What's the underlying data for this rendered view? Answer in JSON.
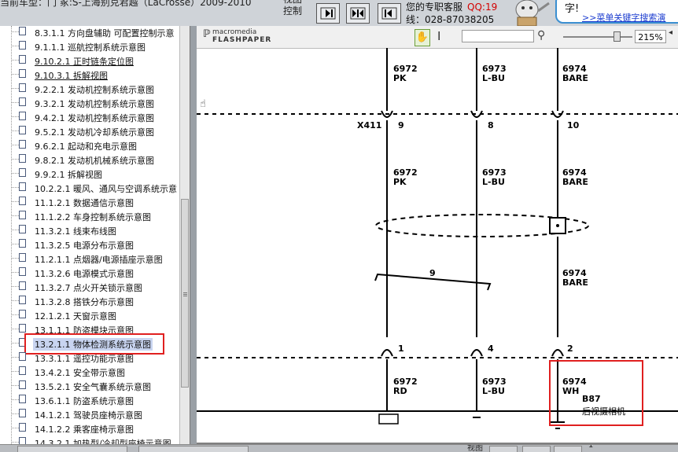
{
  "header": {
    "vehicle_text": "当前车型：门 冢:S-上海别克君越（LaCrosse）2009-2010",
    "view_control_label": "视图控制",
    "service_label": "您的专职客服",
    "qq_label": "QQ:19",
    "phone_label": "线：028-87038205",
    "bubble_title": "字!",
    "bubble_link": ">>菜单关键字搜索演"
  },
  "sidebar": {
    "items": [
      {
        "label": "8.3.1.1 方向盘辅助 可配置控制示意"
      },
      {
        "label": "9.1.1.1 巡航控制系统示意图"
      },
      {
        "label": "9.10.2.1 正时链条定位图"
      },
      {
        "label": "9.10.3.1 拆解视图"
      },
      {
        "label": "9.2.2.1 发动机控制系统示意图"
      },
      {
        "label": "9.3.2.1 发动机控制系统示意图"
      },
      {
        "label": "9.4.2.1 发动机控制系统示意图"
      },
      {
        "label": "9.5.2.1 发动机冷却系统示意图"
      },
      {
        "label": "9.6.2.1 起动和充电示意图"
      },
      {
        "label": "9.8.2.1 发动机机械系统示意图"
      },
      {
        "label": "9.9.2.1 拆解视图"
      },
      {
        "label": "10.2.2.1 暖风、通风与空调系统示意"
      },
      {
        "label": "11.1.2.1 数据通信示意图"
      },
      {
        "label": "11.1.2.2 车身控制系统示意图"
      },
      {
        "label": "11.3.2.1 线束布线图"
      },
      {
        "label": "11.3.2.5 电源分布示意图"
      },
      {
        "label": "11.2.1.1 点烟器/电源插座示意图"
      },
      {
        "label": "11.3.2.6 电源模式示意图"
      },
      {
        "label": "11.3.2.7 点火开关锁示意图"
      },
      {
        "label": "11.3.2.8 搭铁分布示意图"
      },
      {
        "label": "12.1.2.1 天窗示意图"
      },
      {
        "label": "13.1.1.1 防盗模块示意图"
      },
      {
        "label": "13.2.1.1 物体检测系统示意图"
      },
      {
        "label": "13.3.1.1 遥控功能示意图"
      },
      {
        "label": "13.4.2.1 安全带示意图"
      },
      {
        "label": "13.5.2.1 安全气囊系统示意图"
      },
      {
        "label": "13.6.1.1 防盗系统示意图"
      },
      {
        "label": "14.1.2.1 驾驶员座椅示意图"
      },
      {
        "label": "14.1.2.2 乘客座椅示意图"
      },
      {
        "label": "14.3.2.1 加热型/冷却型座椅示意图"
      }
    ],
    "selected_label": "13.2.1.1 物体检测系统示意图"
  },
  "viewer": {
    "brand_top": "macromedia",
    "brand_bottom": "FLASHPAPER",
    "search_value": "",
    "zoom": "215%"
  },
  "diagram": {
    "top_wires": [
      {
        "circuit": "6972",
        "color": "PK"
      },
      {
        "circuit": "6973",
        "color": "L-BU"
      },
      {
        "circuit": "6974",
        "color": "BARE"
      }
    ],
    "connector_x411": {
      "name": "X411",
      "pins": [
        "9",
        "8",
        "10"
      ]
    },
    "mid_wires": [
      {
        "circuit": "6972",
        "color": "PK"
      },
      {
        "circuit": "6973",
        "color": "L-BU"
      },
      {
        "circuit": "6974",
        "color": "BARE"
      }
    ],
    "twist_label": "9",
    "drain_wire": {
      "circuit": "6974",
      "color": "BARE"
    },
    "lower_pins": [
      "1",
      "4",
      "2"
    ],
    "bottom_wires": [
      {
        "circuit": "6972",
        "color": "RD"
      },
      {
        "circuit": "6973",
        "color": "L-BU"
      },
      {
        "circuit": "6974",
        "color": "WH"
      }
    ],
    "component": {
      "id": "B87",
      "name": "后视摄相机"
    }
  },
  "footer": {
    "view_label": "视图",
    "page_label": "1"
  },
  "colors": {
    "highlight_box": "#e02020",
    "selection_bg": "#c8d4f0",
    "qq_red": "#d40000",
    "bubble_border": "#3a8fd1"
  }
}
